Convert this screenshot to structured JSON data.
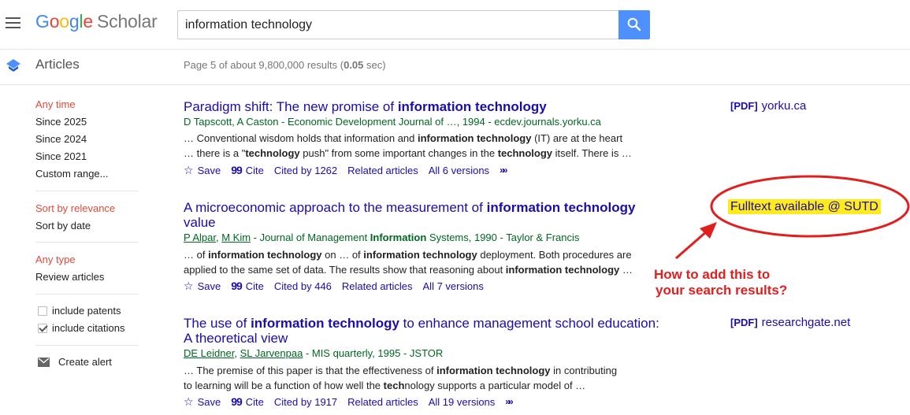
{
  "header": {
    "logo": {
      "letters": [
        "G",
        "o",
        "o",
        "g",
        "l",
        "e"
      ],
      "product": "Scholar"
    },
    "search_value": "information technology"
  },
  "subheader": {
    "section_title": "Articles",
    "results_prefix": "Page 5 of about 9,800,000 results (",
    "results_time": "0.05",
    "results_suffix": " sec)"
  },
  "sidebar": {
    "time_filters": [
      "Any time",
      "Since 2025",
      "Since 2024",
      "Since 2021",
      "Custom range..."
    ],
    "sort_filters": [
      "Sort by relevance",
      "Sort by date"
    ],
    "type_filters": [
      "Any type",
      "Review articles"
    ],
    "include_patents": "include patents",
    "include_citations": "include citations",
    "create_alert": "Create alert"
  },
  "results": [
    {
      "title_pre": "Paradigm shift: The new promise of ",
      "title_bold": "information technology",
      "title_post": "",
      "title_line2": "",
      "meta": "D Tapscott, A Caston - Economic Development Journal of …, 1994 - ecdev.journals.yorku.ca",
      "snippet_line1_a": "… Conventional wisdom holds that information and ",
      "snippet_line1_b": "information technology",
      "snippet_line1_c": " (IT) are at the heart",
      "snippet_line2_a": "… there is a \"",
      "snippet_line2_b": "technology",
      "snippet_line2_c": " push\" from some important changes in the ",
      "snippet_line2_d": "technology",
      "snippet_line2_e": " itself. There is …",
      "save": "Save",
      "cite": "Cite",
      "cited_by": "Cited by 1262",
      "related": "Related articles",
      "versions": "All 6 versions",
      "side_link_tag": "[PDF]",
      "side_link_domain": "yorku.ca"
    },
    {
      "title_pre": "A microeconomic approach to the measurement of ",
      "title_bold": "information technology",
      "title_line2": "value",
      "meta_author1": "P Alpar",
      "meta_sep": ", ",
      "meta_author2": "M Kim",
      "meta_rest_a": " - Journal of Management ",
      "meta_rest_b": "Information",
      "meta_rest_c": " Systems, 1990 - Taylor & Francis",
      "snippet_line1_a": "… of ",
      "snippet_line1_b": "information technology",
      "snippet_line1_c": " on … of ",
      "snippet_line1_d": "information technology",
      "snippet_line1_e": " deployment. Both procedures are",
      "snippet_line2_a": "applied to the same set of data. The results show that reasoning about ",
      "snippet_line2_b": "information technology",
      "snippet_line2_c": " …",
      "save": "Save",
      "cite": "Cite",
      "cited_by": "Cited by 446",
      "related": "Related articles",
      "versions": "All 7 versions",
      "fulltext": "Fulltext available @ SUTD"
    },
    {
      "title_pre": "The use of ",
      "title_bold": "information technology",
      "title_post": " to enhance management school education:",
      "title_line2": "A theoretical view",
      "meta_author1": "DE Leidner",
      "meta_sep": ", ",
      "meta_author2": "SL Jarvenpaa",
      "meta_rest": " - MIS quarterly, 1995 - JSTOR",
      "snippet_line1_a": "… The premise of this paper is that the effectiveness of ",
      "snippet_line1_b": "information technology",
      "snippet_line1_c": " in contributing",
      "snippet_line2_a": "to learning will be a function of how well the ",
      "snippet_line2_b": "tech",
      "snippet_line2_c": "nology supports a particular model of …",
      "save": "Save",
      "cite": "Cite",
      "cited_by": "Cited by 1917",
      "related": "Related articles",
      "versions": "All 19 versions",
      "side_link_tag": "[PDF]",
      "side_link_domain": "researchgate.net"
    }
  ],
  "annotation": {
    "line1": "How to add this to",
    "line2": "your search results?",
    "color": "#e0201f"
  },
  "colors": {
    "link": "#1a0dab",
    "meta_green": "#006621",
    "filter_red": "#dd4b39",
    "search_button": "#4d90fe",
    "highlight": "#ffeb1a"
  }
}
